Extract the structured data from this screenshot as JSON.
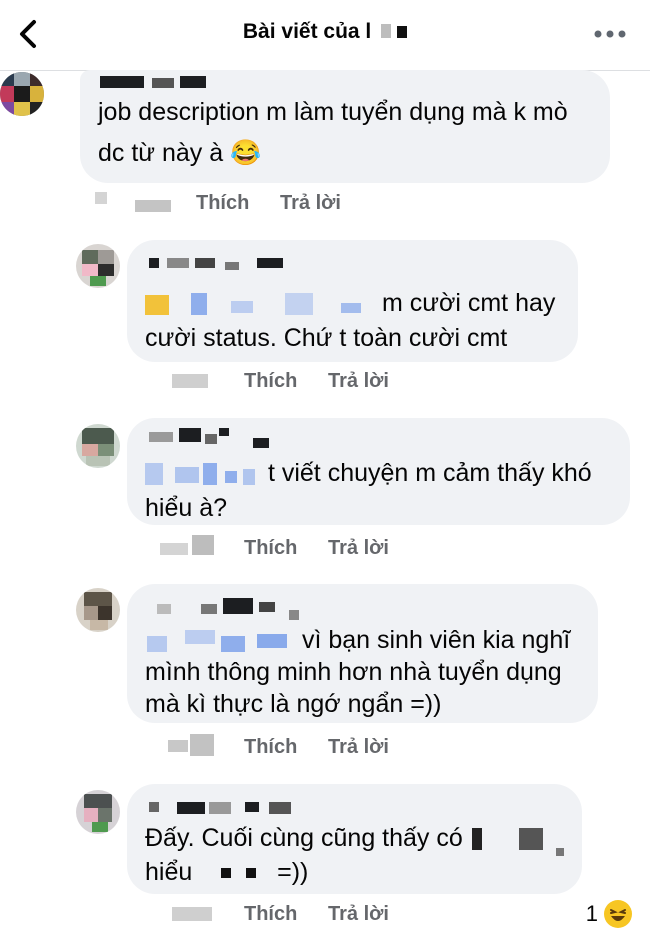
{
  "header": {
    "title": "Bài viết của l",
    "back_icon": "chevron-left-icon",
    "more_icon": "more-dots-icon"
  },
  "comments": [
    {
      "lines": [
        "job description m làm tuyển dụng mà k mò",
        "dc từ này à"
      ],
      "emoji": "😂",
      "like_label": "Thích",
      "reply_label": "Trả lời"
    },
    {
      "lines": [
        "m cười cmt hay",
        "cười status. Chứ t toàn cười cmt"
      ],
      "like_label": "Thích",
      "reply_label": "Trả lời"
    },
    {
      "lines": [
        "t viết chuyện m cảm thấy khó",
        "hiểu à?"
      ],
      "like_label": "Thích",
      "reply_label": "Trả lời"
    },
    {
      "lines": [
        "vì bạn sinh viên kia nghĩ",
        "mình thông minh hơn nhà tuyển dụng",
        "mà kì thực là ngớ ngẩn =))"
      ],
      "like_label": "Thích",
      "reply_label": "Trả lời"
    },
    {
      "lines": [
        "Đấy. Cuối cùng cũng thấy có",
        "hiểu",
        "=))"
      ],
      "like_label": "Thích",
      "reply_label": "Trả lời"
    }
  ],
  "reaction": {
    "count": "1",
    "icon": "laughing-emoji-icon"
  },
  "colors": {
    "bubble": "#f0f2f5",
    "action_text": "#65676b",
    "mention": "#6f97e8",
    "reaction": "#f7c623"
  }
}
